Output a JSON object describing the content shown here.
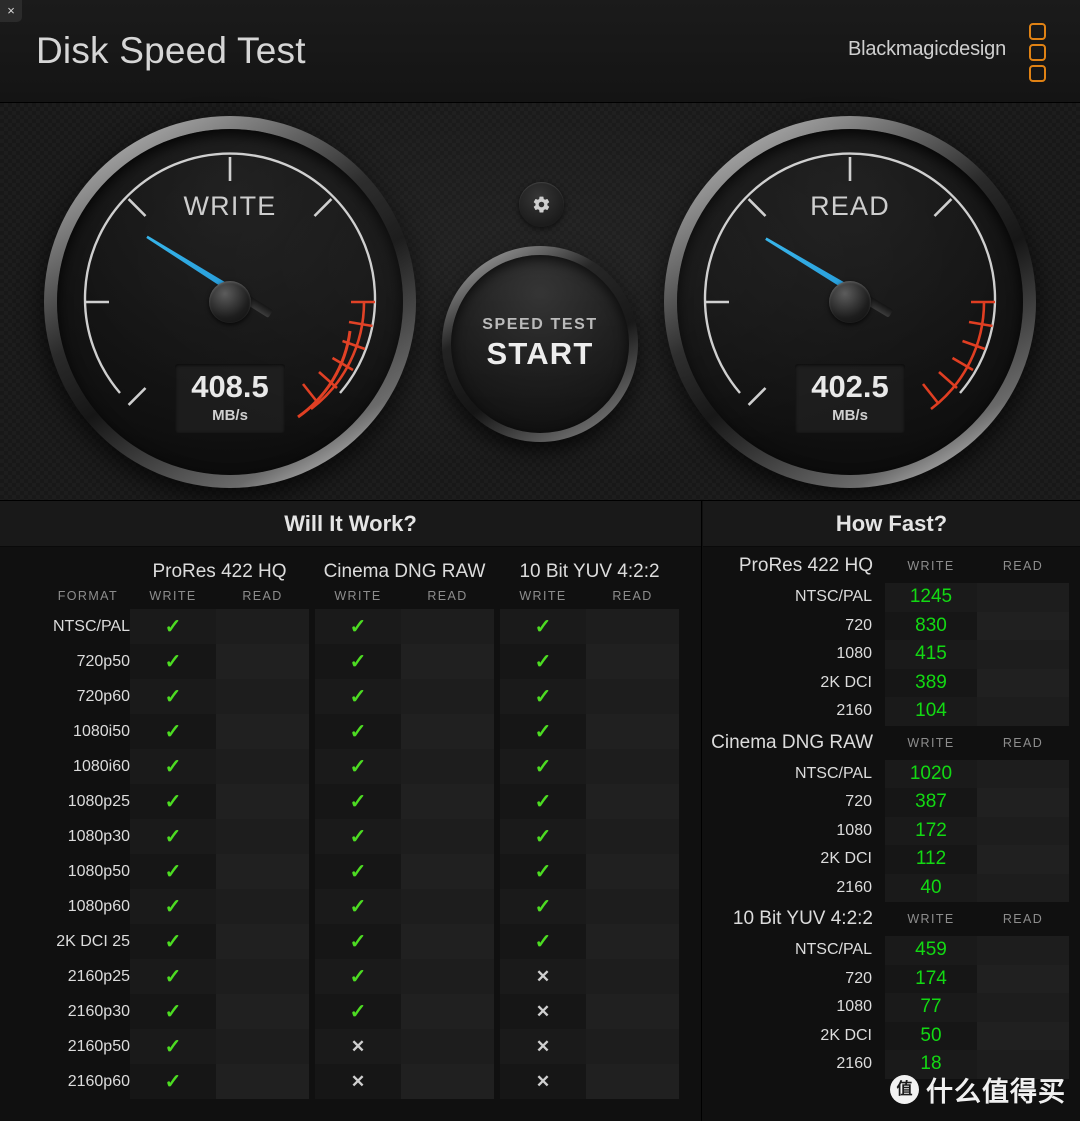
{
  "window": {
    "close_label": "×"
  },
  "header": {
    "title": "Disk Speed Test",
    "brand": "Blackmagicdesign",
    "logo_color": "#e08214"
  },
  "gauges": {
    "write": {
      "label": "WRITE",
      "value": "408.5",
      "unit": "MB/s",
      "needle_angle_deg": 212,
      "needle_color": "#35b4ea"
    },
    "read": {
      "label": "READ",
      "value": "402.5",
      "unit": "MB/s",
      "needle_angle_deg": 211,
      "needle_color": "#35b4ea"
    },
    "redzone_color": "#e03e22",
    "tick_color": "#cfcfcf"
  },
  "center": {
    "gear_icon": "gear-icon",
    "start_line1": "SPEED TEST",
    "start_line2": "START"
  },
  "will_it_work": {
    "title": "Will It Work?",
    "format_header": "FORMAT",
    "codecs": [
      "ProRes 422 HQ",
      "Cinema DNG RAW",
      "10 Bit YUV 4:2:2"
    ],
    "sub_headers": [
      "WRITE",
      "READ"
    ],
    "yes_glyph": "✓",
    "no_glyph": "✕",
    "yes_color": "#4ddc22",
    "no_color": "#cfcfcf",
    "rows": [
      {
        "format": "NTSC/PAL",
        "cells": [
          [
            "yes",
            ""
          ],
          [
            "yes",
            ""
          ],
          [
            "yes",
            ""
          ]
        ]
      },
      {
        "format": "720p50",
        "cells": [
          [
            "yes",
            ""
          ],
          [
            "yes",
            ""
          ],
          [
            "yes",
            ""
          ]
        ]
      },
      {
        "format": "720p60",
        "cells": [
          [
            "yes",
            ""
          ],
          [
            "yes",
            ""
          ],
          [
            "yes",
            ""
          ]
        ]
      },
      {
        "format": "1080i50",
        "cells": [
          [
            "yes",
            ""
          ],
          [
            "yes",
            ""
          ],
          [
            "yes",
            ""
          ]
        ]
      },
      {
        "format": "1080i60",
        "cells": [
          [
            "yes",
            ""
          ],
          [
            "yes",
            ""
          ],
          [
            "yes",
            ""
          ]
        ]
      },
      {
        "format": "1080p25",
        "cells": [
          [
            "yes",
            ""
          ],
          [
            "yes",
            ""
          ],
          [
            "yes",
            ""
          ]
        ]
      },
      {
        "format": "1080p30",
        "cells": [
          [
            "yes",
            ""
          ],
          [
            "yes",
            ""
          ],
          [
            "yes",
            ""
          ]
        ]
      },
      {
        "format": "1080p50",
        "cells": [
          [
            "yes",
            ""
          ],
          [
            "yes",
            ""
          ],
          [
            "yes",
            ""
          ]
        ]
      },
      {
        "format": "1080p60",
        "cells": [
          [
            "yes",
            ""
          ],
          [
            "yes",
            ""
          ],
          [
            "yes",
            ""
          ]
        ]
      },
      {
        "format": "2K DCI 25",
        "cells": [
          [
            "yes",
            ""
          ],
          [
            "yes",
            ""
          ],
          [
            "yes",
            ""
          ]
        ]
      },
      {
        "format": "2160p25",
        "cells": [
          [
            "yes",
            ""
          ],
          [
            "yes",
            ""
          ],
          [
            "no",
            ""
          ]
        ]
      },
      {
        "format": "2160p30",
        "cells": [
          [
            "yes",
            ""
          ],
          [
            "yes",
            ""
          ],
          [
            "no",
            ""
          ]
        ]
      },
      {
        "format": "2160p50",
        "cells": [
          [
            "yes",
            ""
          ],
          [
            "no",
            ""
          ],
          [
            "no",
            ""
          ]
        ]
      },
      {
        "format": "2160p60",
        "cells": [
          [
            "yes",
            ""
          ],
          [
            "no",
            ""
          ],
          [
            "no",
            ""
          ]
        ]
      }
    ]
  },
  "how_fast": {
    "title": "How Fast?",
    "sub_headers": [
      "WRITE",
      "READ"
    ],
    "value_color": "#13d913",
    "groups": [
      {
        "codec": "ProRes 422 HQ",
        "rows": [
          {
            "format": "NTSC/PAL",
            "write": "1245",
            "read": ""
          },
          {
            "format": "720",
            "write": "830",
            "read": ""
          },
          {
            "format": "1080",
            "write": "415",
            "read": ""
          },
          {
            "format": "2K DCI",
            "write": "389",
            "read": ""
          },
          {
            "format": "2160",
            "write": "104",
            "read": ""
          }
        ]
      },
      {
        "codec": "Cinema DNG RAW",
        "rows": [
          {
            "format": "NTSC/PAL",
            "write": "1020",
            "read": ""
          },
          {
            "format": "720",
            "write": "387",
            "read": ""
          },
          {
            "format": "1080",
            "write": "172",
            "read": ""
          },
          {
            "format": "2K DCI",
            "write": "112",
            "read": ""
          },
          {
            "format": "2160",
            "write": "40",
            "read": ""
          }
        ]
      },
      {
        "codec": "10 Bit YUV 4:2:2",
        "rows": [
          {
            "format": "NTSC/PAL",
            "write": "459",
            "read": ""
          },
          {
            "format": "720",
            "write": "174",
            "read": ""
          },
          {
            "format": "1080",
            "write": "77",
            "read": ""
          },
          {
            "format": "2K DCI",
            "write": "50",
            "read": ""
          },
          {
            "format": "2160",
            "write": "18",
            "read": ""
          }
        ]
      }
    ]
  },
  "watermark": {
    "badge": "值",
    "text": "什么值得买"
  }
}
